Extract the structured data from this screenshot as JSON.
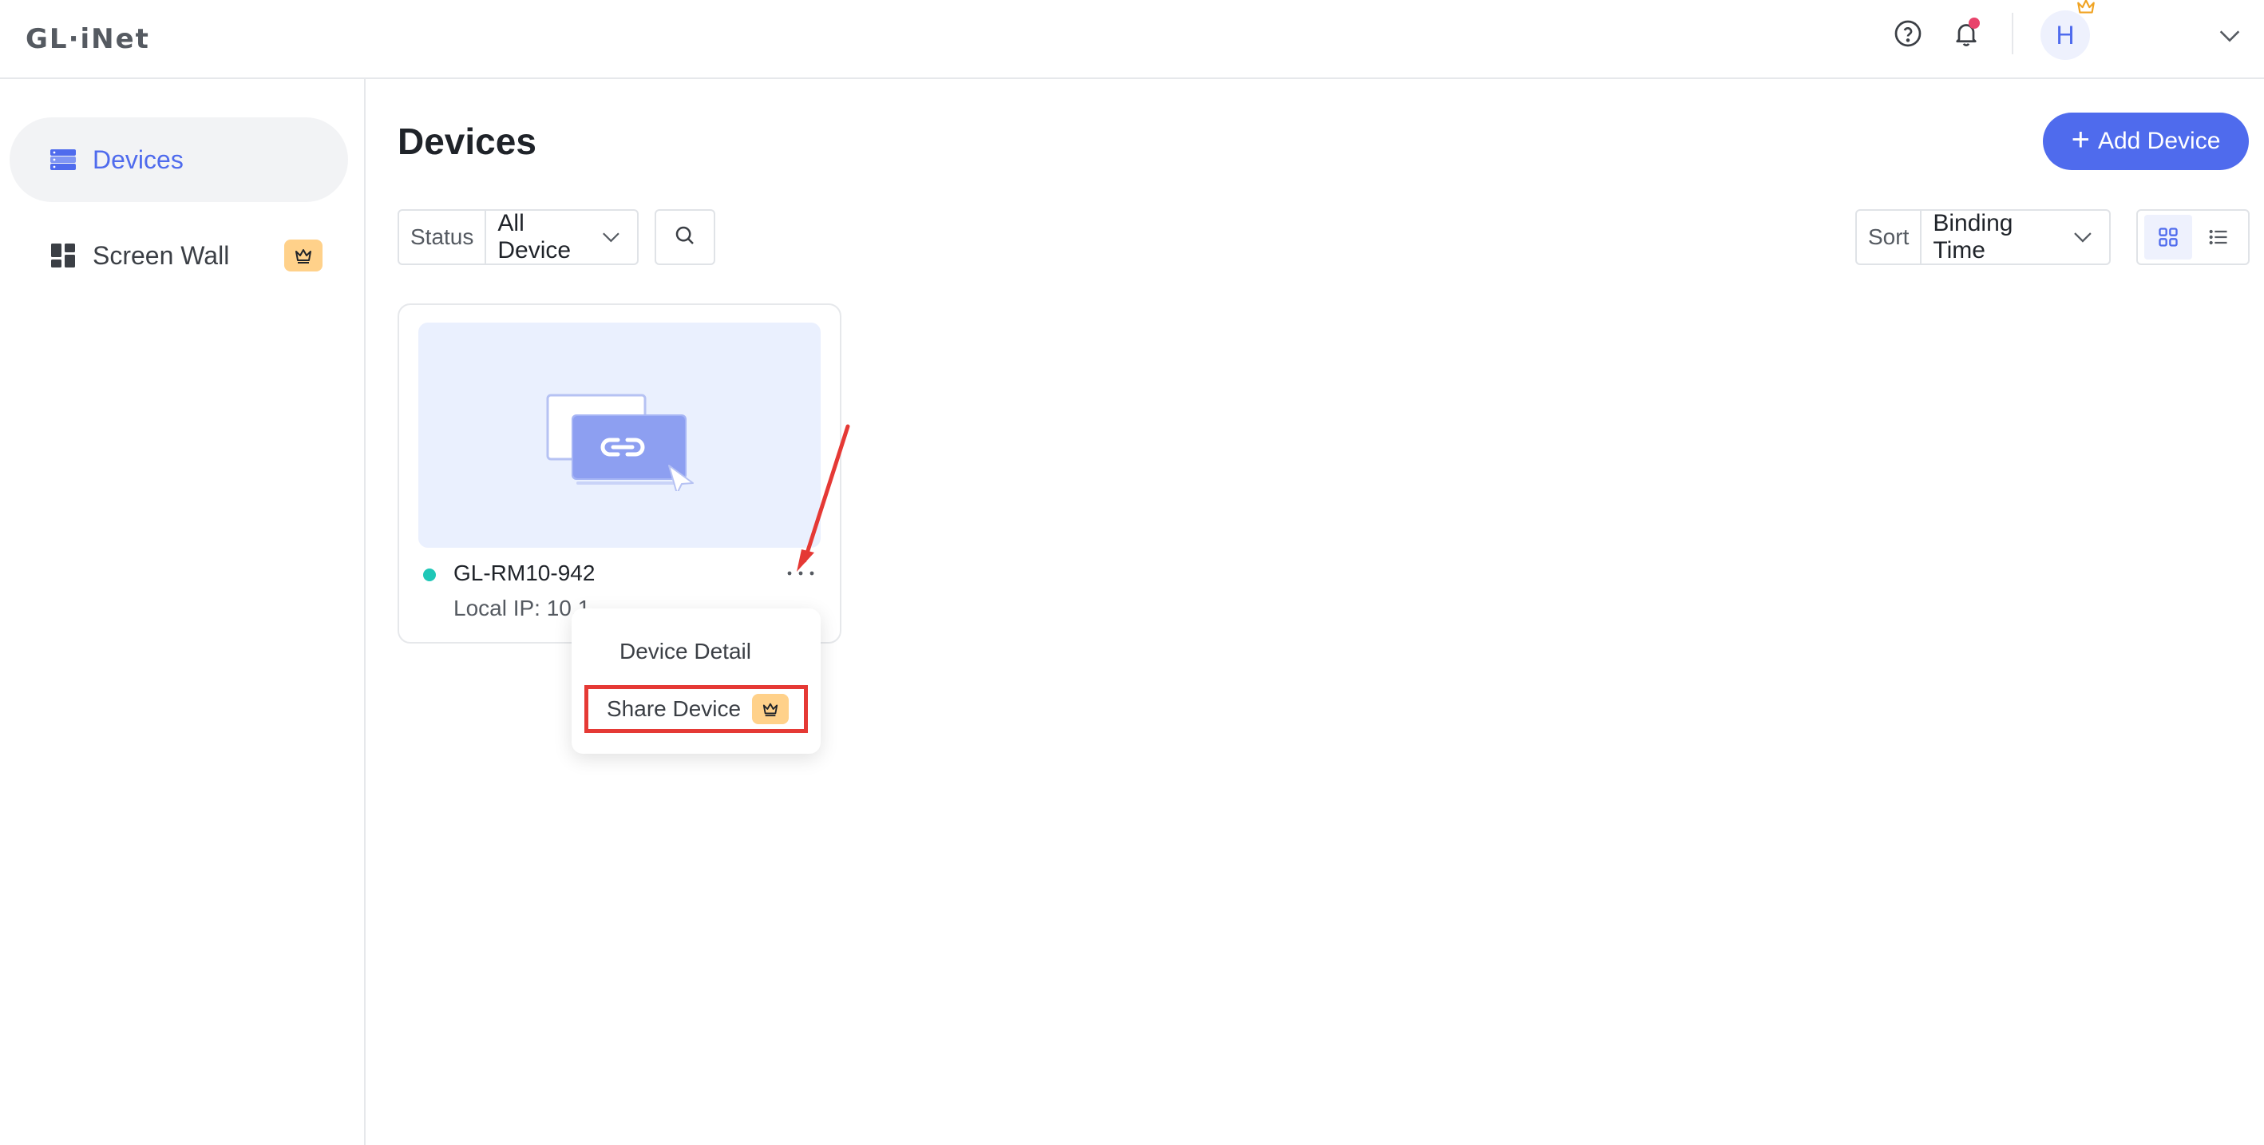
{
  "header": {
    "logo_text": "GL·iNet",
    "avatar_initial": "H",
    "icons": [
      "help-icon",
      "bell-icon",
      "crown-icon",
      "chevron-down-icon"
    ]
  },
  "sidebar": {
    "items": [
      {
        "label": "Devices",
        "icon": "devices-icon",
        "active": true
      },
      {
        "label": "Screen Wall",
        "icon": "grid-icon",
        "premium": true
      }
    ]
  },
  "main": {
    "title": "Devices",
    "add_button_label": "Add Device",
    "status_filter": {
      "label": "Status",
      "value": "All Device"
    },
    "sort_filter": {
      "label": "Sort",
      "value": "Binding Time"
    },
    "view_modes": [
      "grid",
      "list"
    ],
    "active_view": "grid"
  },
  "devices": [
    {
      "name": "GL-RM10-942",
      "local_ip": "Local IP: 10.1",
      "online": true
    }
  ],
  "menu": {
    "items": [
      "Device Detail",
      "Share Device"
    ]
  },
  "colors": {
    "accent": "#4f6bed",
    "online": "#1fc7b7",
    "premium_badge": "#ffd18a",
    "highlight": "#e53935",
    "notification_dot": "#e8436b"
  }
}
